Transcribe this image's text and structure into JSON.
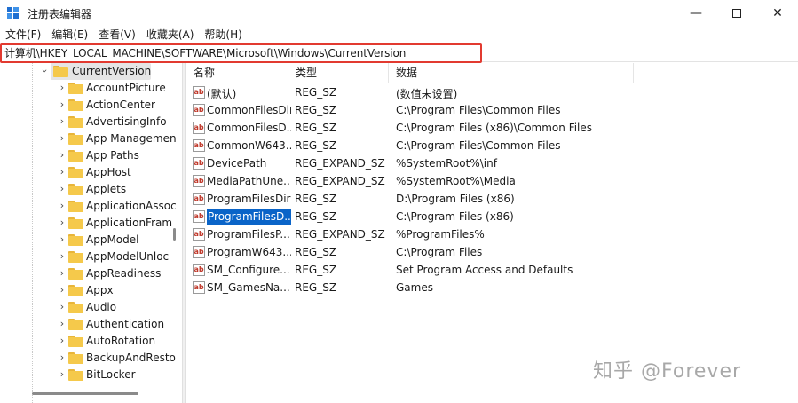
{
  "window": {
    "title": "注册表编辑器",
    "minimize": "—",
    "close": "✕"
  },
  "menu": [
    "文件(F)",
    "编辑(E)",
    "查看(V)",
    "收藏夹(A)",
    "帮助(H)"
  ],
  "address": {
    "path": "计算机\\HKEY_LOCAL_MACHINE\\SOFTWARE\\Microsoft\\Windows\\CurrentVersion",
    "highlight_color": "#e23a30"
  },
  "tree": {
    "selected": "CurrentVersion",
    "children": [
      "AccountPicture",
      "ActionCenter",
      "AdvertisingInfo",
      "App Managemen",
      "App Paths",
      "AppHost",
      "Applets",
      "ApplicationAssoc",
      "ApplicationFram",
      "AppModel",
      "AppModelUnloc",
      "AppReadiness",
      "Appx",
      "Audio",
      "Authentication",
      "AutoRotation",
      "BackupAndResto",
      "BitLocker"
    ]
  },
  "columns": {
    "name": "名称",
    "type": "类型",
    "data": "数据"
  },
  "values": [
    {
      "icon": "ab",
      "name": "(默认)",
      "type": "REG_SZ",
      "data": "(数值未设置)"
    },
    {
      "icon": "ab",
      "name": "CommonFilesDir",
      "type": "REG_SZ",
      "data": "C:\\Program Files\\Common Files"
    },
    {
      "icon": "ab",
      "name": "CommonFilesD...",
      "type": "REG_SZ",
      "data": "C:\\Program Files (x86)\\Common Files"
    },
    {
      "icon": "ab",
      "name": "CommonW643...",
      "type": "REG_SZ",
      "data": "C:\\Program Files\\Common Files"
    },
    {
      "icon": "ab",
      "name": "DevicePath",
      "type": "REG_EXPAND_SZ",
      "data": "%SystemRoot%\\inf"
    },
    {
      "icon": "ab",
      "name": "MediaPathUne...",
      "type": "REG_EXPAND_SZ",
      "data": "%SystemRoot%\\Media"
    },
    {
      "icon": "ab",
      "name": "ProgramFilesDir",
      "type": "REG_SZ",
      "data": "D:\\Program Files (x86)"
    },
    {
      "icon": "ab",
      "name": "ProgramFilesD...",
      "type": "REG_SZ",
      "data": "C:\\Program Files (x86)",
      "selected": true
    },
    {
      "icon": "ab",
      "name": "ProgramFilesP...",
      "type": "REG_EXPAND_SZ",
      "data": "%ProgramFiles%"
    },
    {
      "icon": "ab",
      "name": "ProgramW643...",
      "type": "REG_SZ",
      "data": "C:\\Program Files"
    },
    {
      "icon": "ab",
      "name": "SM_Configure...",
      "type": "REG_SZ",
      "data": "Set Program Access and Defaults"
    },
    {
      "icon": "ab",
      "name": "SM_GamesNa...",
      "type": "REG_SZ",
      "data": "Games"
    }
  ],
  "watermark": "知乎 @Forever",
  "colors": {
    "selection": "#0a64c8",
    "folder": "#f5c94b",
    "tree_selected_bg": "#e5e5e5"
  }
}
